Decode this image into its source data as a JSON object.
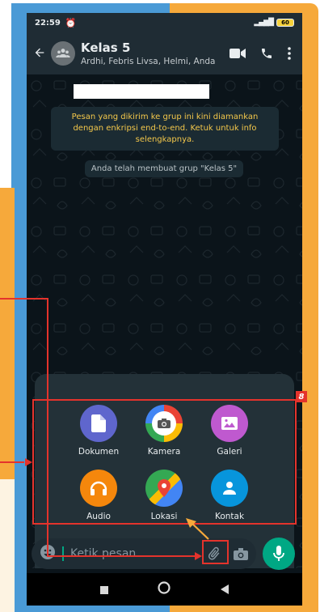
{
  "status_bar": {
    "time": "22:59",
    "battery": "60"
  },
  "header": {
    "title": "Kelas 5",
    "subtitle": "Ardhi, Febris Livsa, Helmi, Anda",
    "icons": [
      "back-arrow-icon",
      "group-icon",
      "video-call-icon",
      "phone-icon",
      "more-vert-icon"
    ]
  },
  "chat": {
    "encryption_notice": "Pesan yang dikirim ke grup ini kini diamankan dengan enkripsi end-to-end. Ketuk untuk info selengkapnya.",
    "system_message": "Anda telah membuat grup \"Kelas 5\""
  },
  "attach_menu": {
    "items": [
      {
        "label": "Dokumen",
        "icon": "document-icon",
        "color": "#5f66cd"
      },
      {
        "label": "Kamera",
        "icon": "camera-icon",
        "color": "#d3396d"
      },
      {
        "label": "Galeri",
        "icon": "gallery-icon",
        "color": "#bf59cf"
      },
      {
        "label": "Audio",
        "icon": "headphones-icon",
        "color": "#f5870c"
      },
      {
        "label": "Lokasi",
        "icon": "location-icon",
        "color": "#1fa855"
      },
      {
        "label": "Kontak",
        "icon": "contact-icon",
        "color": "#0795dc"
      }
    ]
  },
  "composer": {
    "placeholder": "Ketik pesan"
  },
  "annotation": {
    "badge": "8",
    "color": "#e4332c",
    "arrow_color": "#f6a93b"
  },
  "colors": {
    "blue_panel": "#4a9ad6",
    "orange_panel": "#f6a93b",
    "whatsapp_green": "#00a884",
    "app_bar": "#1f2c34"
  }
}
